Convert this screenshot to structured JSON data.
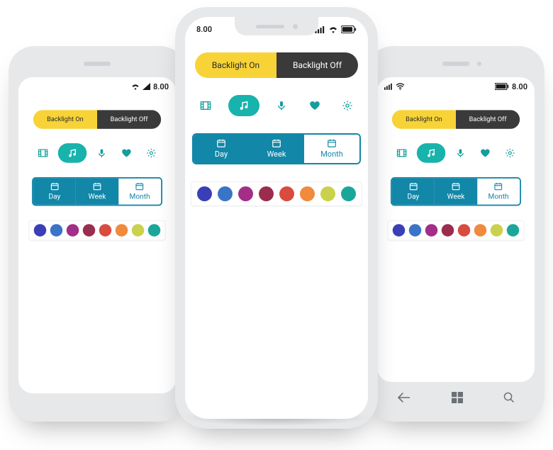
{
  "statusbar": {
    "time": "8.00",
    "icons": {
      "wifi": "wifi-icon",
      "signal": "signal-icon",
      "battery": "battery-icon"
    }
  },
  "backlight": {
    "on_label": "Backlight On",
    "off_label": "Backlight Off",
    "selected": "on",
    "on_color": "#f7d337",
    "off_color": "#3a3a3a"
  },
  "iconrow": {
    "items": [
      {
        "name": "film-icon",
        "active": false
      },
      {
        "name": "music-icon",
        "active": true
      },
      {
        "name": "mic-icon",
        "active": false
      },
      {
        "name": "heart-icon",
        "active": false
      },
      {
        "name": "gear-icon",
        "active": false
      }
    ],
    "accent": "#149e9c",
    "active_bg": "#17b3ac"
  },
  "view_segment": {
    "items": [
      {
        "label": "Day",
        "selected": false
      },
      {
        "label": "Week",
        "selected": false
      },
      {
        "label": "Month",
        "selected": true
      }
    ],
    "color": "#1287a8"
  },
  "swatches": [
    "#3a3fb7",
    "#3a74c7",
    "#a22e88",
    "#9a2d4d",
    "#d94b3f",
    "#f08a3c",
    "#c9d24a",
    "#1aa79a"
  ],
  "winnav": {
    "back": "back-icon",
    "start": "windows-icon",
    "search": "search-icon"
  }
}
